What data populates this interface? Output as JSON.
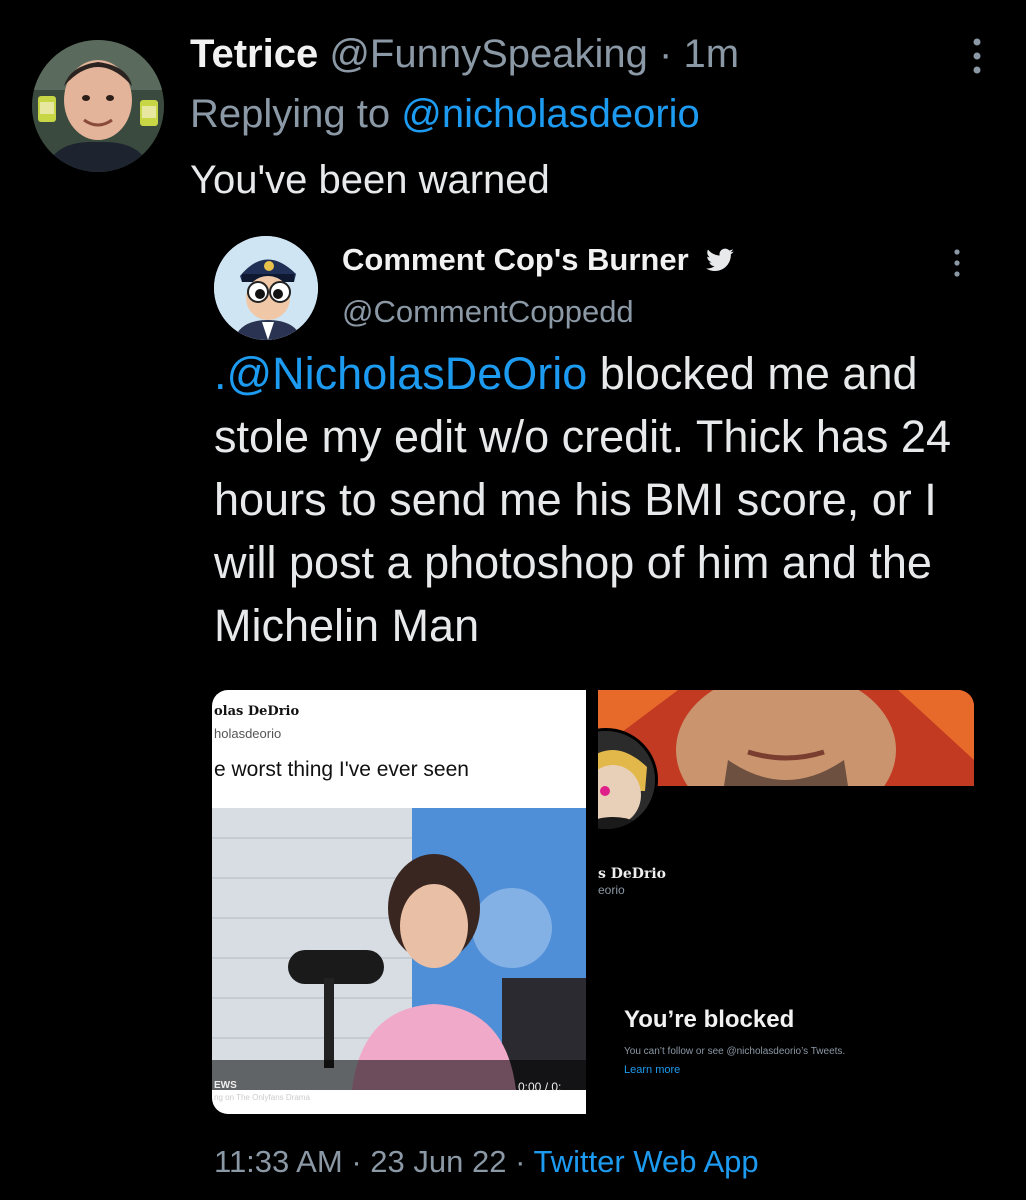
{
  "tweet": {
    "name": "Tetrice",
    "handle": "@FunnySpeaking",
    "separator": "·",
    "time": "1m",
    "reply_prefix": "Replying to",
    "reply_to": "@nicholasdeorio",
    "text": "You've been warned",
    "avatar_icon": "user-avatar-photo",
    "more_icon": "more-vertical-icon"
  },
  "quote": {
    "name": "Comment Cop's Burner",
    "handle": "@CommentCoppedd",
    "verified_icon": "twitter-bird-icon",
    "mention": ".@NicholasDeOrio",
    "text": " blocked me and stole my edit w/o credit. Thick has 24 hours to send me his BMI score, or I will post a photoshop of him and the Michelin Man",
    "footer": {
      "time": "11:33 AM",
      "separator1": "·",
      "date": "23 Jun 22",
      "separator2": "·",
      "app": "Twitter Web App"
    }
  },
  "media_left": {
    "name": "olas DeDrio",
    "handle": "holasdeorio",
    "text": "e worst thing I've ever seen",
    "footer_brand": "EWS",
    "footer_caption": "ng on The Onlyfans Drama",
    "timecode": "0:00 / 0:"
  },
  "media_right": {
    "name": "s DeDrio",
    "handle": "eorio",
    "blocked_title": "You’re blocked",
    "blocked_sub": "You can’t follow or see @nicholasdeorio’s Tweets.",
    "learn_more": "Learn more"
  },
  "colors": {
    "background": "#000000",
    "text": "#e7e9ea",
    "secondary": "#8b98a5",
    "link": "#1d9bf0"
  }
}
